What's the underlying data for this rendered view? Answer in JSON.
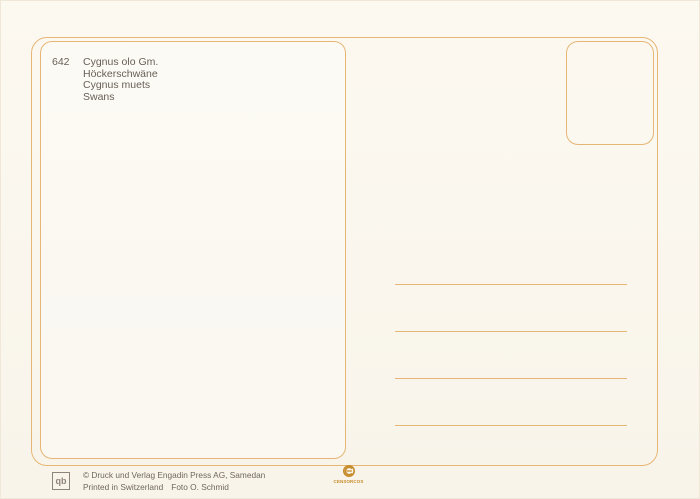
{
  "caption": {
    "number": "642",
    "lines": [
      "Cygnus olo Gm.",
      "Höckerschwäne",
      "Cygnus muets",
      "Swans"
    ]
  },
  "footer": {
    "logo_symbol": "qb",
    "publisher_line": "© Druck und Verlag Engadin Press AG, Samedan",
    "printed_in": "Printed in Switzerland",
    "photo_credit": "Foto O. Schmid",
    "brand_mark": "CENSORCOS"
  },
  "colors": {
    "frame": "#e6b676",
    "text": "#675f57",
    "muted": "#8d847a",
    "accent": "#c68b2b"
  },
  "icons": {
    "publisher_badge": "publisher-badge-icon",
    "brand_logo": "brand-logo-icon"
  }
}
